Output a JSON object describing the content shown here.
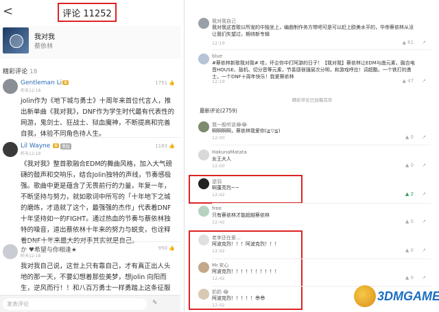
{
  "left": {
    "back_glyph": "<",
    "title": "评论 11252",
    "song": {
      "name": "我对我",
      "artist": "蔡依林"
    },
    "section": {
      "label": "精彩评论",
      "count": "18"
    },
    "comments": [
      {
        "user": "Gentleman Li",
        "badge": "",
        "time": "昨天12:18",
        "likes": "1751",
        "text": "jolin作为《地下城与勇士》十周年来首位代言人，推出新单曲《我对我》，DNF作为学生时代最有代表性的网游，鬼剑士、狂战士、狱血魔神，不断提高和完善自我，体验不同角色待人生。"
      },
      {
        "user": "Lil Wayne",
        "badge": "黑胶",
        "time": "昨天12:18",
        "likes": "1183",
        "text": "《我对我》整首歌融合EDM的舞曲风格，加入大气磅礴的鼓声和交响乐，结合Jolin独特的声线，节奏感极强。歌曲中更是蕴含了无畏前行的力量，年复一年，不断坚持与努力，就如歌词中所写的「十年地下之城的磨炼，才造就了这个，最强强的杰作」代表着DNF十年坚持如一的FIGHT。通过热血的节奏与蔡依林独特的噪音，道出蔡依林十年来的努力与蜕变，也诠释着DNF十年来最大的对手其实就是自己。"
      },
      {
        "user": "か ♥希望与你相逢★",
        "badge": "",
        "time": "昨天12:18",
        "likes": "950",
        "text": "我对我自己说，这世上只有靠自己，才有真正出人头地的那一天，不要幻想着那些美梦，想jolin 向阳而生，逆风而行！！和八百万勇士一样勇踏上这条征服人生的"
      }
    ],
    "input_placeholder": "发表评论",
    "send_glyph": "✎"
  },
  "right": {
    "top_comments": [
      {
        "user": "我对我自己",
        "time": "12:19",
        "likes": "61",
        "text": "我对我这首歌以所宠的中独坐上，编曲制作务方带吧可是可以赶上欧美水平的，华帝蔡依林从没让我们失望过，期待新专辑"
      },
      {
        "user": "blue",
        "time": "12:19",
        "likes": "47",
        "text": "#蔡依林新歌我对我# 哇，坏企你中打阿游的日子！【我对我】蔡依林让EDM与曲元素，融合电音HOUSE、鼓机、切分音等元素，节奏感很强层次分明，和游戏呼应！词超酷，一个铁打的勇士，一个DNF十周年快乐！我爱蔡依林"
      }
    ],
    "loaded_text": "精彩评论已加载完毕",
    "latest_label": "最新评论(2759)",
    "latest": [
      {
        "user": "我一般听说😂😂",
        "time": "12:00",
        "likes": "0",
        "text": "啊啊啊啊，蔡依林我爱你(≧▽≦)"
      },
      {
        "user": "HakunaMatata",
        "time": "12:00",
        "likes": "0",
        "text": "女王大人"
      },
      {
        "user": "逆羽",
        "time": "12:42",
        "likes": "2",
        "text": "啊蓬亮烈~~"
      },
      {
        "user": "free",
        "time": "12:42",
        "likes": "0",
        "text": "只有蔡依林才能超越蔡依林"
      },
      {
        "user": "老李还在爱…",
        "time": "12:42",
        "likes": "0",
        "text": "阿波克烈！！！阿波克烈！！！"
      },
      {
        "user": "Mr.安心",
        "time": "12:42",
        "likes": "0",
        "text": "阿波克烈！！！！！！！！！！"
      },
      {
        "user": "奶奶 😂",
        "time": "12:42",
        "likes": "0",
        "text": "阿波克烈！！！！！😎😎"
      }
    ],
    "share_glyph": "↗",
    "like_glyph": "▲"
  },
  "watermark": {
    "text": "3DMGAME"
  },
  "colors": {
    "highlight": "#dd2222",
    "link": "#2a6bb3",
    "like_active": "#2f9e53"
  }
}
